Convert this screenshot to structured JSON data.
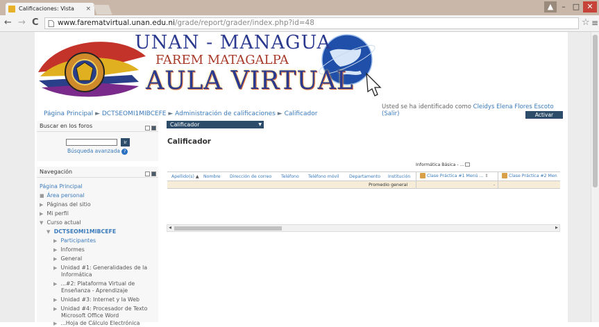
{
  "browser": {
    "tab_title": "Calificaciones: Vista",
    "tab_close": "×",
    "url_host": "www.farematvirtual.unan.edu.ni",
    "url_path": "/grade/report/grader/index.php?id=48",
    "nav_back": "←",
    "nav_forward": "→",
    "nav_reload": "C",
    "star": "☆",
    "menu": "≡",
    "win_user": "▲",
    "win_min": "–",
    "win_max": "□",
    "win_close": "✕"
  },
  "banner": {
    "line1": "UNAN - MANAGUA",
    "line2": "FAREM MATAGALPA",
    "line3": "AULA VIRTUAL"
  },
  "breadcrumb": {
    "home": "Página Principal",
    "sep": "►",
    "course": "DCTSEOMI1MIBCEFE",
    "admin": "Administración de calificaciones",
    "current": "Calificador"
  },
  "login": {
    "prefix": "Usted se ha identificado como",
    "user": "Cleidys Elena Flores Escoto (Salir)"
  },
  "edit_button": "Activar edición",
  "search_block": {
    "title": "Buscar en los foros",
    "go": "Ir",
    "advanced": "Búsqueda avanzada",
    "help": "?"
  },
  "nav_block": {
    "title": "Navegación",
    "items": [
      {
        "label": "Página Principal",
        "marker": ""
      },
      {
        "label": "Área personal",
        "marker": "■"
      },
      {
        "label": "Páginas del sitio",
        "marker": "▶"
      },
      {
        "label": "Mi perfil",
        "marker": "▶"
      },
      {
        "label": "Curso actual",
        "marker": "▼"
      },
      {
        "label": "DCTSEOMI1MIBCEFE",
        "marker": "▼"
      },
      {
        "label": "Participantes",
        "marker": "▶"
      },
      {
        "label": "Informes",
        "marker": "▶"
      },
      {
        "label": "General",
        "marker": "▶"
      },
      {
        "label": "Unidad #1: Generalidades de la",
        "label2": "Informática",
        "marker": "▶"
      },
      {
        "label": "...#2: Plataforma Virtual de",
        "label2": "Enseñanza - Aprendizaje",
        "marker": "▶"
      },
      {
        "label": "Unidad #3: Internet y la Web",
        "marker": "▶"
      },
      {
        "label": "Unidad #4: Procesador de Texto",
        "label2": "Microsoft Office Word",
        "marker": "▶"
      },
      {
        "label": "...Hoja de Cálculo Electrónica",
        "marker": "▶"
      }
    ]
  },
  "main": {
    "jump_select": "Calificador",
    "jump_arrow": "▼",
    "heading": "Calificador",
    "category": "Informática Básica - ...",
    "columns": [
      "Apellido(s)",
      "Nombre",
      "Dirección de correo",
      "Teléfono",
      "Teléfono móvil",
      "Departamento",
      "Institución"
    ],
    "sort_icon": "▲",
    "item1": "Clase Práctica #1 Menú ...",
    "item2": "Clase Práctica #2 Men",
    "average_label": "Promedio general",
    "average_value": "-",
    "scroll_left": "◂",
    "scroll_right": "▸"
  }
}
